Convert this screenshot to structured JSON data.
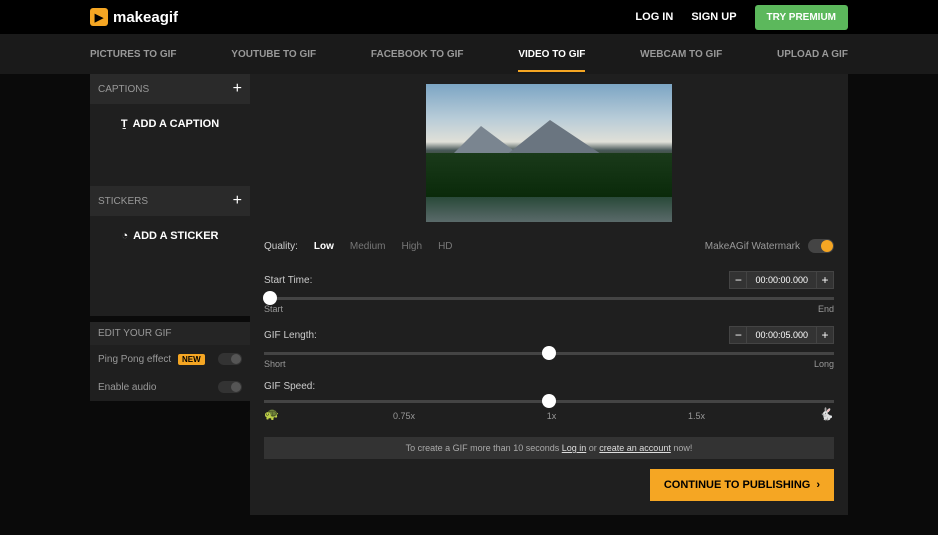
{
  "header": {
    "logo_text": "makeagif",
    "login": "LOG IN",
    "signup": "SIGN UP",
    "premium": "TRY PREMIUM"
  },
  "nav": {
    "items": [
      "PICTURES TO GIF",
      "YOUTUBE TO GIF",
      "FACEBOOK TO GIF",
      "VIDEO TO GIF",
      "WEBCAM TO GIF",
      "UPLOAD A GIF"
    ],
    "active_index": 3
  },
  "sidebar": {
    "captions": {
      "title": "CAPTIONS",
      "button": "ADD A CAPTION"
    },
    "stickers": {
      "title": "STICKERS",
      "button": "ADD A STICKER"
    },
    "edit": {
      "title": "EDIT YOUR GIF",
      "pingpong": "Ping Pong effect",
      "new_badge": "NEW",
      "audio": "Enable audio"
    }
  },
  "quality": {
    "label": "Quality:",
    "options": [
      "Low",
      "Medium",
      "High",
      "HD"
    ],
    "active": "Low",
    "watermark_label": "MakeAGif Watermark"
  },
  "controls": {
    "start": {
      "label": "Start Time:",
      "value": "00:00:00.000",
      "left": "Start",
      "right": "End",
      "thumb_pos": "1%"
    },
    "length": {
      "label": "GIF Length:",
      "value": "00:00:05.000",
      "left": "Short",
      "right": "Long",
      "thumb_pos": "50%"
    },
    "speed": {
      "label": "GIF Speed:",
      "ticks": [
        "0.75x",
        "1x",
        "1.5x"
      ],
      "thumb_pos": "50%"
    }
  },
  "footer": {
    "info_pre": "To create a GIF more than 10 seconds ",
    "login_link": "Log in",
    "info_mid": " or ",
    "create_link": "create an account",
    "info_post": " now!",
    "continue": "CONTINUE TO PUBLISHING"
  }
}
